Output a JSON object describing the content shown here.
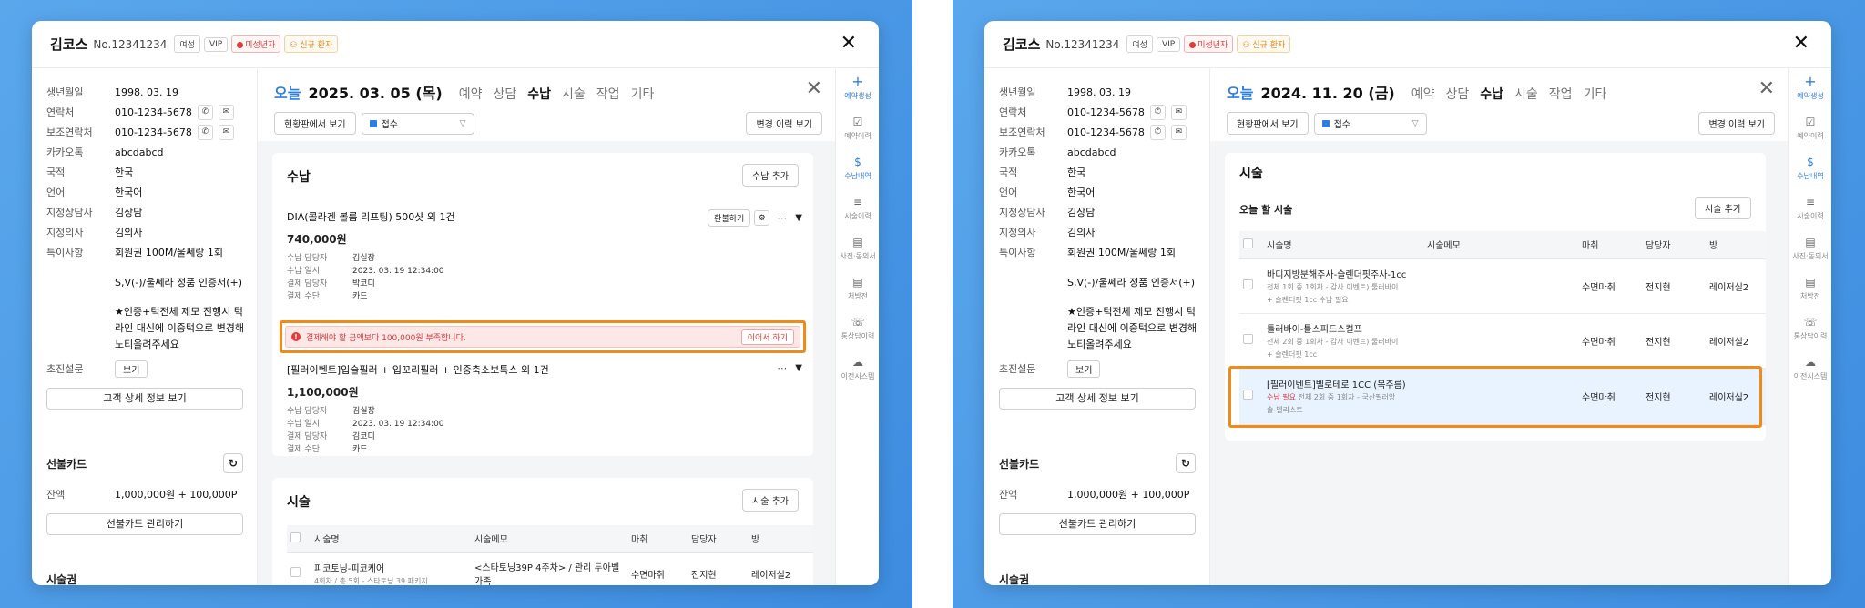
{
  "colors": {
    "accent": "#2f7de1",
    "highlight": "#f28a18",
    "alert_red": "#e23b3b",
    "background": "#4a98e6"
  },
  "patient": {
    "name": "김코스",
    "no": "No.12341234",
    "badges": [
      "여성",
      "VIP",
      "미성년자",
      "신규 환자"
    ]
  },
  "info": {
    "birth_label": "생년월일",
    "birth": "1998. 03. 19",
    "phone_label": "연락처",
    "phone": "010-1234-5678",
    "phone2_label": "보조연락처",
    "phone2": "010-1234-5678",
    "kakao_label": "카카오톡",
    "kakao": "abcdabcd",
    "nation_label": "국적",
    "nation": "한국",
    "lang_label": "언어",
    "lang": "한국어",
    "counselor_label": "지정상담사",
    "counselor": "김상담",
    "doctor_label": "지정의사",
    "doctor": "김의사",
    "notes_label": "특이사항",
    "notes": "회원권 100M/울쎄랑 1회",
    "memo1": "S,V(-)/울쎄라 정품 인증서(+)",
    "memo2": "★인증+턱전체 제모 진행시 턱라인 대신에 이중턱으로 변경해 노티올려주세요",
    "survey_label": "초진설문",
    "survey_btn": "보기",
    "detail_btn": "고객 상세 정보 보기"
  },
  "prepaid": {
    "title": "선불카드",
    "balance_label": "잔액",
    "balance": "1,000,000원 + 100,000P",
    "manage_btn": "선불카드 관리하기"
  },
  "voucher_title": "시술권",
  "tabs": [
    "예약",
    "상담",
    "수납",
    "시술",
    "작업",
    "기타"
  ],
  "today_label": "오늘",
  "controls": {
    "board_btn": "현황판에서 보기",
    "status": "접수",
    "history_btn": "변경 이력 보기"
  },
  "rail": [
    {
      "label": "예약생성",
      "icon": "+"
    },
    {
      "label": "예약이력",
      "icon": "☑"
    },
    {
      "label": "수납내역",
      "icon": "$"
    },
    {
      "label": "시술이력",
      "icon": "≡"
    },
    {
      "label": "사진·동의서",
      "icon": "▤"
    },
    {
      "label": "처방전",
      "icon": "▤"
    },
    {
      "label": "통상담이력",
      "icon": "☏"
    },
    {
      "label": "이전시스템",
      "icon": "☁"
    }
  ],
  "left": {
    "date": "2025. 03. 05 (목)",
    "payment": {
      "title": "수납",
      "add_btn": "수납 추가",
      "items": [
        {
          "title": "DIA(콜라겐 볼륨 리프팅) 500샷 외 1건",
          "amount": "740,000원",
          "refund_btn": "환불하기",
          "rows": [
            {
              "k": "수납 담당자",
              "v": "김실장"
            },
            {
              "k": "수납 일시",
              "v": "2023. 03. 19 12:34:00"
            },
            {
              "k": "결제 담당자",
              "v": "박코디"
            },
            {
              "k": "결제 수단",
              "v": "카드"
            }
          ]
        },
        {
          "title": "[필러이벤트]입술필러 + 입꼬리필러 + 인중축소보톡스 외 1건",
          "amount": "1,100,000원",
          "rows": [
            {
              "k": "수납 담당자",
              "v": "김실장"
            },
            {
              "k": "수납 일시",
              "v": "2023. 03. 19 12:34:00"
            },
            {
              "k": "결제 담당자",
              "v": "김코디"
            },
            {
              "k": "결제 수단",
              "v": "카드"
            }
          ]
        }
      ],
      "alert": "결제해야 할 금액보다 100,000원 부족합니다.",
      "alert_btn": "이어서 하기"
    },
    "procedure": {
      "title": "시술",
      "add_btn": "시술 추가",
      "headers": [
        "시술명",
        "시술메모",
        "마취",
        "담당자",
        "방"
      ],
      "rows": [
        {
          "name": "피코토닝-피코케어",
          "sub": "4회차 / 총 5회 - 스타토닝 39 패키지",
          "memo": "<스타토닝39P 4주차> / 관리 두아벨 가족",
          "anesthesia": "수면마취",
          "staff": "전지현",
          "room": "레이저실2"
        }
      ]
    }
  },
  "right": {
    "date": "2024. 11. 20 (금)",
    "procedure": {
      "title": "시술",
      "subtitle": "오늘 할 시술",
      "add_btn": "시술 추가",
      "headers": [
        "시술명",
        "시술메모",
        "마취",
        "담당자",
        "방"
      ],
      "rows": [
        {
          "name": "바디지방분해주사-슬렌더핏주사-1cc",
          "sub1": "전체 1회 중 1회차 - 감사 이벤트) 툴러바이",
          "sub2": "+ 슬렌더핏 1cc 수납 필요",
          "anesthesia": "수면마취",
          "staff": "전지현",
          "room": "레이저실2"
        },
        {
          "name": "툴러바이-툴스피드스컬프",
          "sub1": "전체 2회 중 1회차 - 감사 이벤트) 툴러바이",
          "sub2": "+ 슬렌더핏 1cc",
          "anesthesia": "수면마취",
          "staff": "전지현",
          "room": "레이저실2"
        },
        {
          "name": "[필러이벤트]벨로테로 1CC (목주름)",
          "tag": "수납 필요",
          "sub1": "전체 2회 중 1회차 - 국산필러앙",
          "sub2": "솔-벨리스트",
          "anesthesia": "수면마취",
          "staff": "전지현",
          "room": "레이저실2"
        }
      ]
    }
  }
}
